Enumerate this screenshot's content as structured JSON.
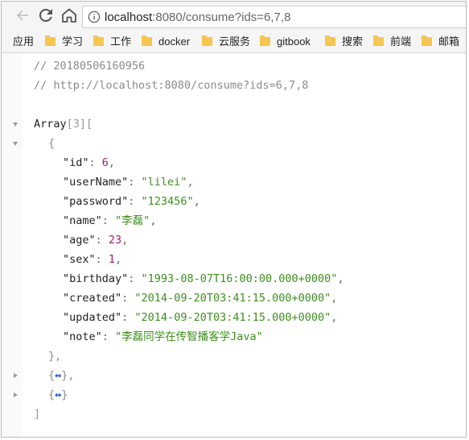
{
  "browser": {
    "url_host": "localhost",
    "url_rest": ":8080/consume?ids=6,7,8",
    "icons": {
      "back": "back-arrow-icon",
      "reload": "reload-icon",
      "home": "home-icon",
      "info": "info-icon"
    }
  },
  "bookmarks": [
    {
      "label": "应用",
      "folder": false
    },
    {
      "label": "学习",
      "folder": true
    },
    {
      "label": "工作",
      "folder": true
    },
    {
      "label": "docker",
      "folder": true
    },
    {
      "label": "云服务",
      "folder": true
    },
    {
      "label": "gitbook",
      "folder": true
    },
    {
      "label": "搜索",
      "folder": true
    },
    {
      "label": "前端",
      "folder": true
    },
    {
      "label": "邮箱",
      "folder": true
    }
  ],
  "json_view": {
    "comment_timestamp": "// 20180506160956",
    "comment_url": "// http://localhost:8080/consume?ids=6,7,8",
    "array_label": "Array",
    "array_count": "[3]",
    "fields": [
      {
        "key": "\"id\"",
        "value": "6",
        "type": "number"
      },
      {
        "key": "\"userName\"",
        "value": "\"lilei\"",
        "type": "string"
      },
      {
        "key": "\"password\"",
        "value": "\"123456\"",
        "type": "string"
      },
      {
        "key": "\"name\"",
        "value": "\"李磊\"",
        "type": "string"
      },
      {
        "key": "\"age\"",
        "value": "23",
        "type": "number"
      },
      {
        "key": "\"sex\"",
        "value": "1",
        "type": "number"
      },
      {
        "key": "\"birthday\"",
        "value": "\"1993-08-07T16:00:00.000+0000\"",
        "type": "string"
      },
      {
        "key": "\"created\"",
        "value": "\"2014-09-20T03:41:15.000+0000\"",
        "type": "string"
      },
      {
        "key": "\"updated\"",
        "value": "\"2014-09-20T03:41:15.000+0000\"",
        "type": "string"
      },
      {
        "key": "\"note\"",
        "value": "\"李磊同学在传智播客学Java\"",
        "type": "string"
      }
    ],
    "collapsed_ellipsis": "↔",
    "colors": {
      "string": "#3e8f1e",
      "number": "#a31d6f",
      "comment": "#8a8a8a",
      "ellipsis": "#1a56d6"
    }
  }
}
